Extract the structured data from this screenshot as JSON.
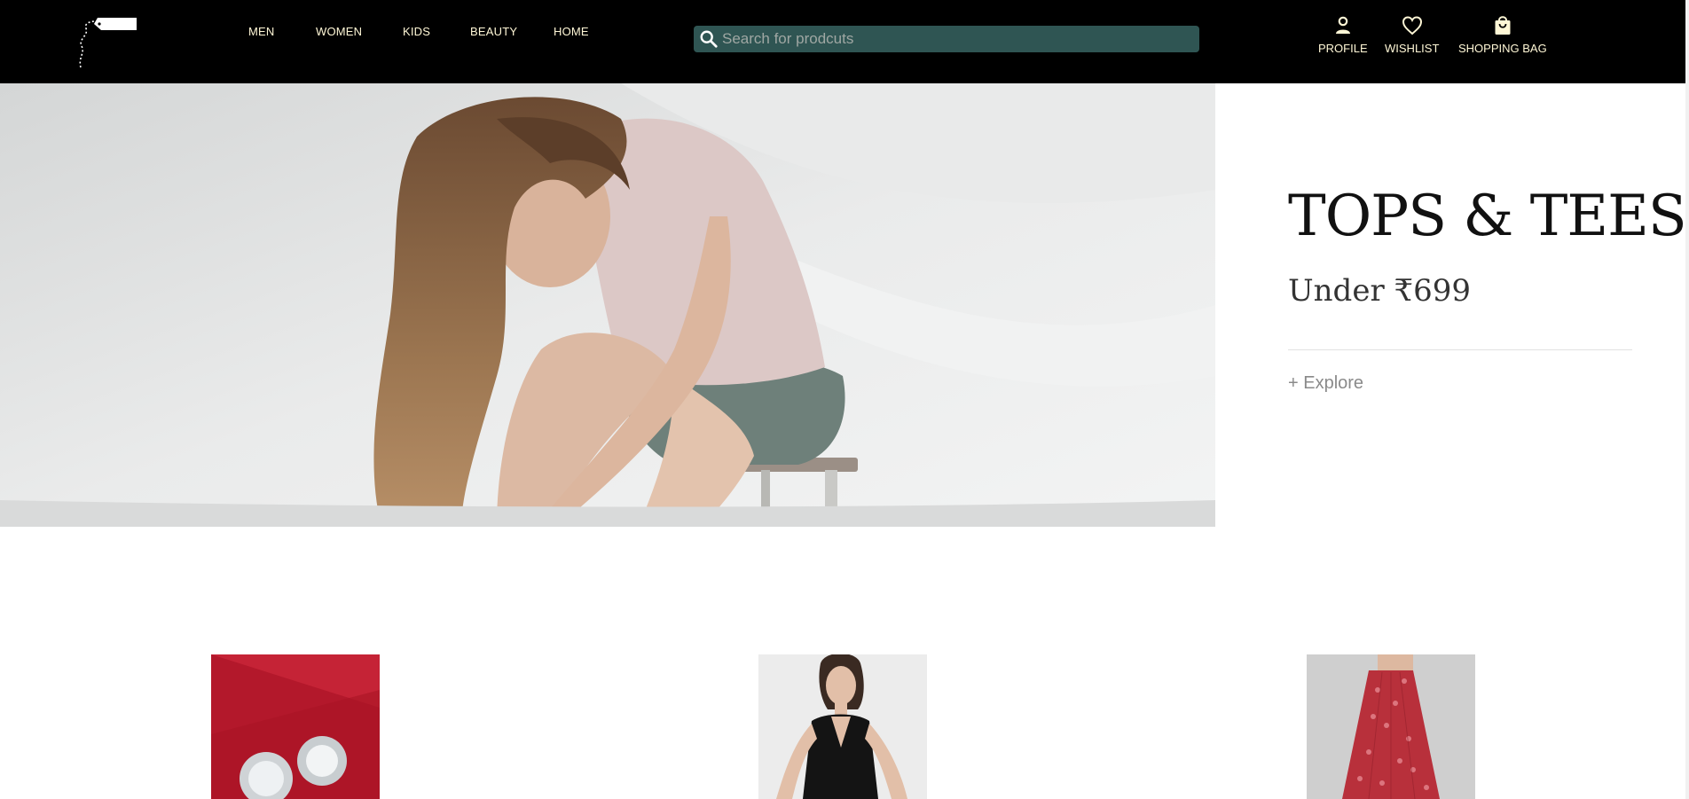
{
  "nav": {
    "items": [
      {
        "label": "MEN"
      },
      {
        "label": "WOMEN"
      },
      {
        "label": "KIDS"
      },
      {
        "label": "BEAUTY"
      },
      {
        "label": "HOME"
      }
    ]
  },
  "search": {
    "placeholder": "Search for prodcuts",
    "value": ""
  },
  "actions": {
    "profile": "PROFILE",
    "wishlist": "WISHLIST",
    "bag": "SHOPPING BAG"
  },
  "hero": {
    "title": "TOPS & TEES",
    "subtitle": "Under ₹699",
    "cta": "+ Explore"
  },
  "colors": {
    "header_bg": "#000000",
    "nav_text": "#fff7d6",
    "search_bg": "#2f5553"
  },
  "icons": {
    "logo": "price-tag-logo",
    "search": "search-icon",
    "profile": "person-icon",
    "wishlist": "heart-icon",
    "bag": "shopping-bag-icon"
  }
}
